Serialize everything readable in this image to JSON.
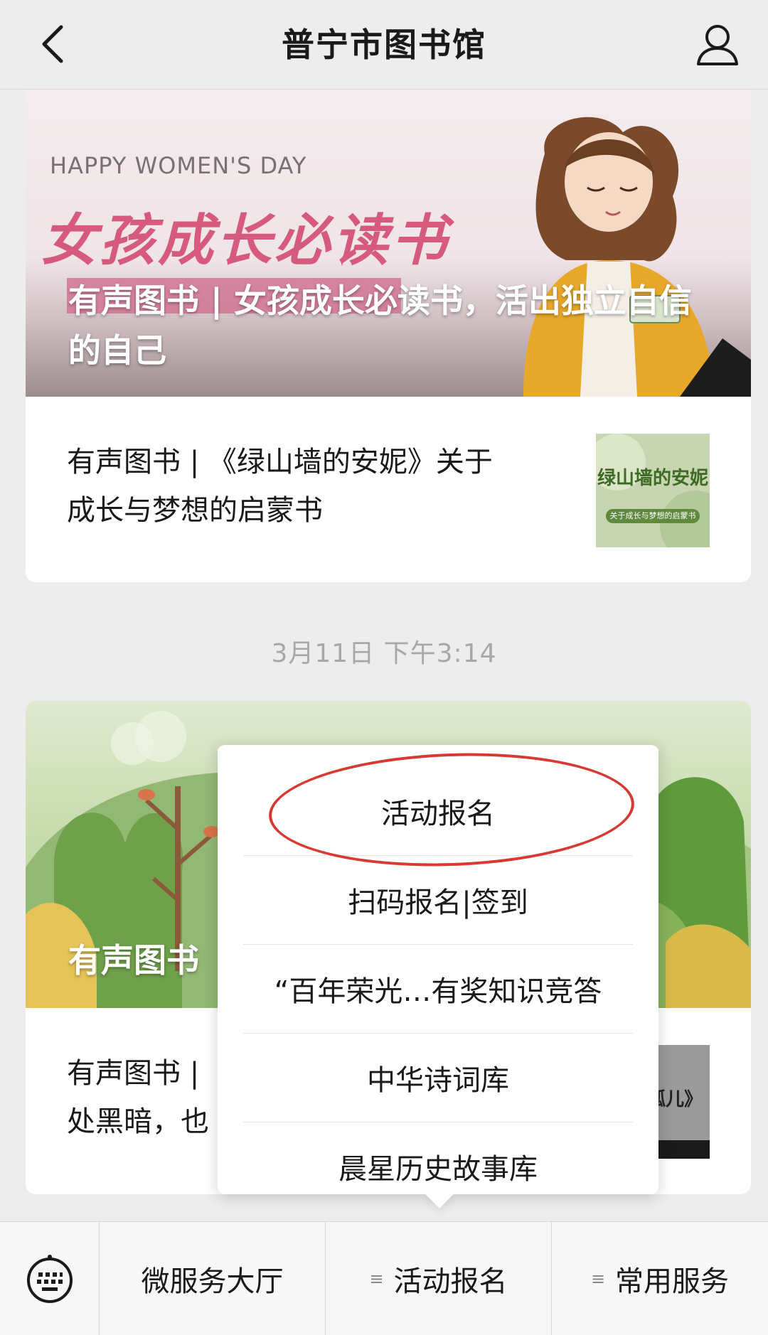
{
  "header": {
    "title": "普宁市图书馆",
    "back_icon": "chevron-left-icon",
    "profile_icon": "user-profile-icon"
  },
  "feed": {
    "article1": {
      "cover_text_en": "HAPPY WOMEN'S DAY",
      "cover_text_cn": "女孩成长必读书",
      "title": "有声图书 | 女孩成长必读书，活出独立自信的自己",
      "sub_title": "有声图书 | 《绿山墙的安妮》关于成长与梦想的启蒙书",
      "thumb_title": "绿山墙的安妮",
      "thumb_subtitle": "关于成长与梦想的启蒙书"
    },
    "timestamp": "3月11日 下午3:14",
    "article2": {
      "title_visible": "有声图书",
      "sub_title_line1": "有声图书 |",
      "sub_title_line2": "处黑暗，也",
      "thumb_text": "孤儿》"
    }
  },
  "popup_menu": {
    "items": [
      "活动报名",
      "扫码报名|签到",
      "“百年荣光…有奖知识竞答",
      "中华诗词库",
      "晨星历史故事库"
    ],
    "highlight_color": "#d83a33"
  },
  "bottom_bar": {
    "keyboard_icon": "keyboard-icon",
    "tabs": [
      "微服务大厅",
      "活动报名",
      "常用服务"
    ],
    "menu_mark": "≡"
  }
}
